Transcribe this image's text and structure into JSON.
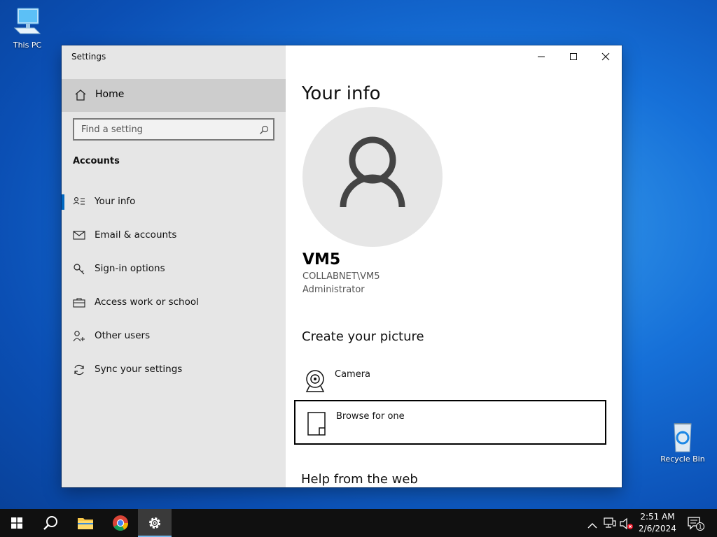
{
  "desktop": {
    "this_pc_label": "This PC",
    "recycle_bin_label": "Recycle Bin"
  },
  "window": {
    "title": "Settings"
  },
  "sidebar": {
    "home_label": "Home",
    "search_placeholder": "Find a setting",
    "section_title": "Accounts",
    "items": [
      {
        "label": "Your info",
        "icon": "your-info-icon",
        "active": true
      },
      {
        "label": "Email & accounts",
        "icon": "mail-icon"
      },
      {
        "label": "Sign-in options",
        "icon": "key-icon"
      },
      {
        "label": "Access work or school",
        "icon": "briefcase-icon"
      },
      {
        "label": "Other users",
        "icon": "person-add-icon"
      },
      {
        "label": "Sync your settings",
        "icon": "sync-icon"
      }
    ]
  },
  "main": {
    "page_title": "Your info",
    "user": {
      "name": "VM5",
      "account": "COLLABNET\\VM5",
      "role": "Administrator"
    },
    "create_picture_title": "Create your picture",
    "camera_label": "Camera",
    "browse_label": "Browse for one",
    "help_title": "Help from the web"
  },
  "taskbar": {
    "time": "2:51 AM",
    "date": "2/6/2024",
    "notification_count": "1"
  },
  "colors": {
    "accent": "#0067c0",
    "sidebar_bg": "#e6e6e6",
    "taskbar_bg": "#101010"
  }
}
